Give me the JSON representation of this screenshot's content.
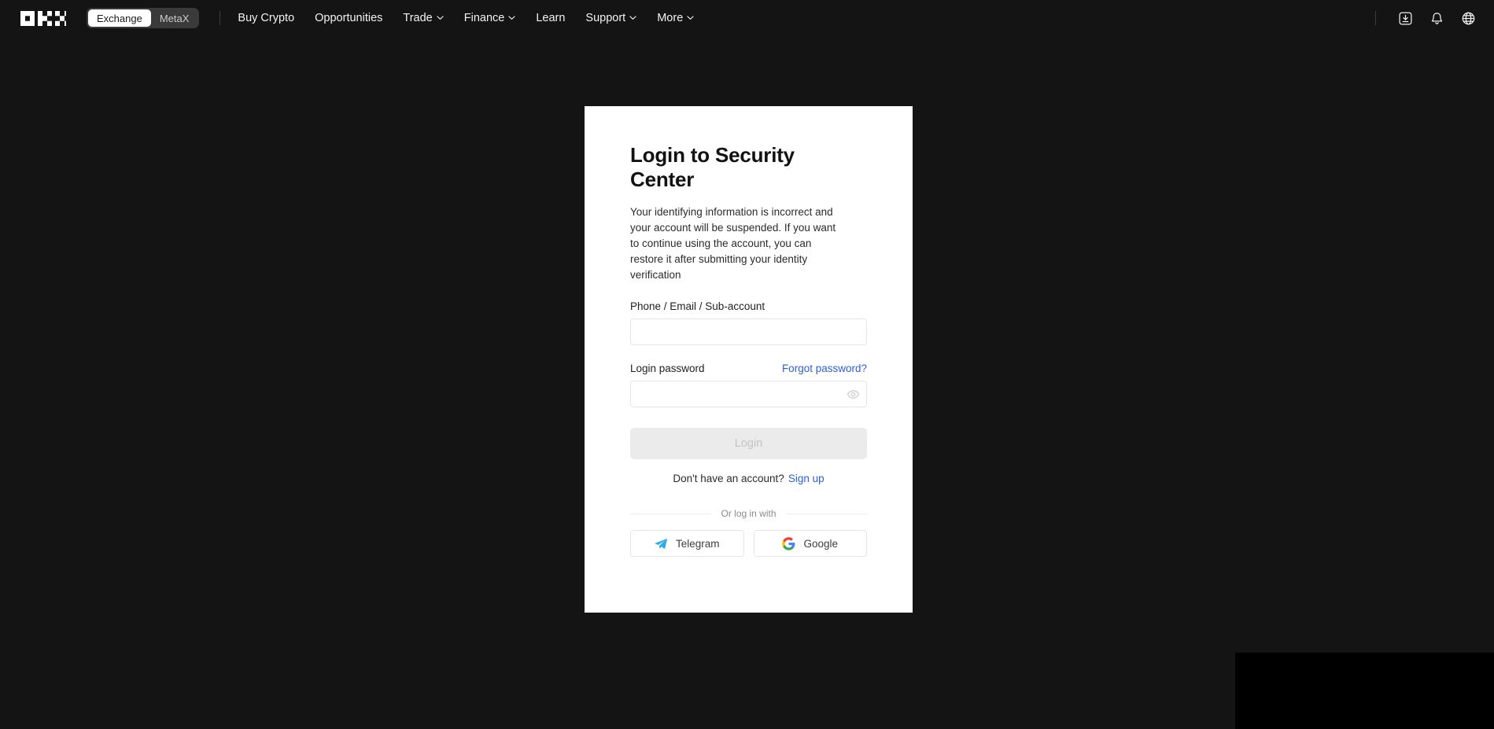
{
  "nav": {
    "logo_name": "okx-logo",
    "segmented": {
      "options": [
        {
          "label": "Exchange",
          "active": true
        },
        {
          "label": "MetaX",
          "active": false
        }
      ]
    },
    "links": [
      {
        "label": "Buy Crypto",
        "has_caret": false
      },
      {
        "label": "Opportunities",
        "has_caret": false
      },
      {
        "label": "Trade",
        "has_caret": true
      },
      {
        "label": "Finance",
        "has_caret": true
      },
      {
        "label": "Learn",
        "has_caret": false
      },
      {
        "label": "Support",
        "has_caret": true
      },
      {
        "label": "More",
        "has_caret": true
      }
    ],
    "right_icons": [
      {
        "name": "download-icon"
      },
      {
        "name": "notification-bell-icon"
      },
      {
        "name": "language-globe-icon"
      }
    ]
  },
  "card": {
    "title": "Login to Security Center",
    "description": "Your identifying information is incorrect and your account will be suspended. If you want to continue using the account, you can restore it after submitting your identity verification",
    "account_field": {
      "label": "Phone / Email / Sub-account",
      "value": "",
      "placeholder": ""
    },
    "password_field": {
      "label": "Login password",
      "forgot_label": "Forgot password?",
      "value": "",
      "placeholder": "",
      "toggle_icon": "eye-icon"
    },
    "login_button": {
      "label": "Login",
      "disabled": true
    },
    "signup": {
      "prompt": "Don't have an account?",
      "link_label": "Sign up"
    },
    "divider_label": "Or log in with",
    "social_buttons": [
      {
        "label": "Telegram",
        "icon": "telegram-icon"
      },
      {
        "label": "Google",
        "icon": "google-icon"
      }
    ]
  },
  "colors": {
    "page_background": "#141414",
    "card_background": "#ffffff",
    "link_blue": "#2b5fe3",
    "disabled_button": "#ebebeb",
    "disabled_button_text": "#c4c4c4",
    "corner_panel": "#000000"
  }
}
